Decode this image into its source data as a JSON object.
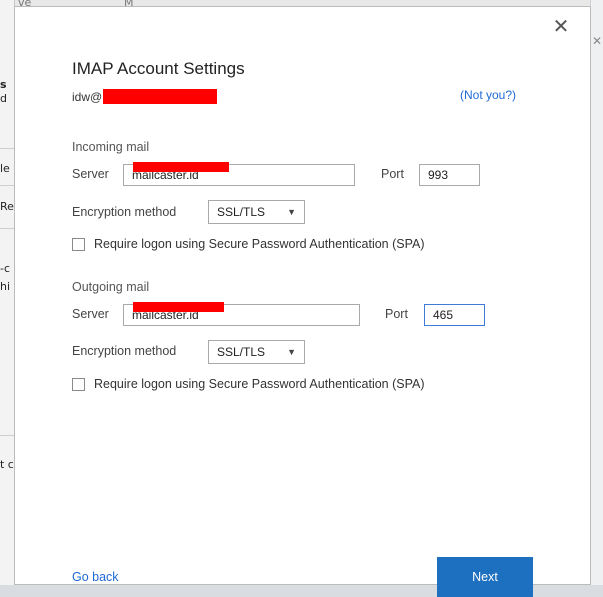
{
  "background_app": {
    "left_fragments": [
      "s",
      "d",
      "le",
      "Re",
      "-c",
      "hi",
      "t c"
    ],
    "top_fragments": [
      "ve",
      "M"
    ]
  },
  "dialog": {
    "close_glyph": "✕",
    "title": "IMAP Account Settings",
    "account_prefix": "idw@",
    "not_you_link": "(Not you?)",
    "incoming": {
      "section_label": "Incoming mail",
      "server_label": "Server",
      "server_value": "mailcaster.id",
      "port_label": "Port",
      "port_value": "993",
      "encryption_label": "Encryption method",
      "encryption_value": "SSL/TLS",
      "spa_label": "Require logon using Secure Password Authentication (SPA)",
      "spa_checked": false
    },
    "outgoing": {
      "section_label": "Outgoing mail",
      "server_label": "Server",
      "server_value": "mailcaster.id",
      "port_label": "Port",
      "port_value": "465",
      "encryption_label": "Encryption method",
      "encryption_value": "SSL/TLS",
      "spa_label": "Require logon using Secure Password Authentication (SPA)",
      "spa_checked": false
    },
    "go_back_link": "Go back",
    "next_button": "Next"
  },
  "icons": {
    "dropdown": "chevron-down-icon",
    "close": "close-icon"
  },
  "colors": {
    "accent": "#1d6fbf",
    "link": "#1f6ad4",
    "redaction": "#ff0000"
  }
}
